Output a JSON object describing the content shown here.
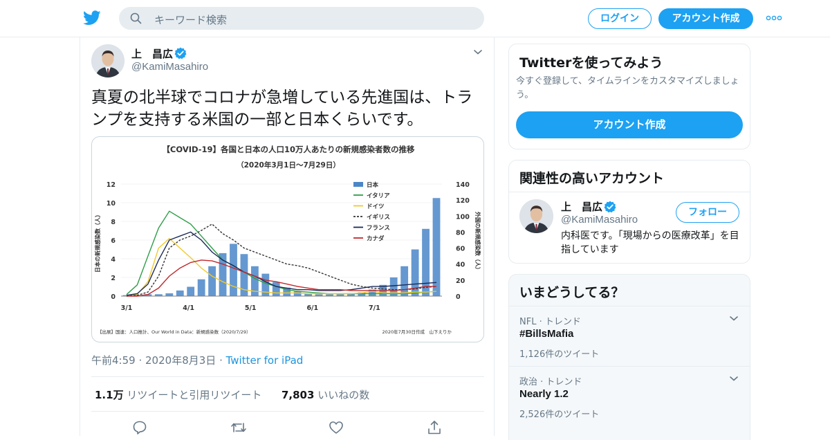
{
  "header": {
    "search_placeholder": "キーワード検索",
    "login_label": "ログイン",
    "signup_label": "アカウント作成"
  },
  "tweet": {
    "author_name": "上　昌広",
    "author_handle": "@KamiMasahiro",
    "text": "真夏の北半球でコロナが急増している先進国は、トランプを支持する米国の一部と日本くらいです。",
    "time": "午前4:59",
    "date": "2020年8月3日",
    "source": "Twitter for iPad",
    "retweet_count": "1.1万",
    "retweet_label": "リツイートと引用リツイート",
    "like_count": "7,803",
    "like_label": "いいねの数"
  },
  "chart_image": {
    "title": "【COVID-19】各国と日本の人口10万人あたりの新規感染者数の推移",
    "subtitle": "（2020年3月1日〜7月29日）",
    "ylabel_left": "日本の新規感染数（人）",
    "ylabel_right": "外国の新規感染数（人）",
    "source_note": "【出展】国連：人口推計、Our World in Data：新規感染数（2020/7/29）",
    "credit_note": "2020年7月30日作成　山下えりか"
  },
  "chart_data": {
    "type": "bar",
    "title": "【COVID-19】各国と日本の人口10万人あたりの新規感染者数の推移",
    "subtitle": "（2020年3月1日〜7月29日）",
    "xlabel": "",
    "ylabel": "日本の新規感染数（人）",
    "ylabel_right": "外国の新規感染数（人）",
    "x_ticks": [
      "3/1",
      "4/1",
      "5/1",
      "6/1",
      "7/1"
    ],
    "y_ticks_left": [
      "0",
      "2",
      "4",
      "6",
      "8",
      "10",
      "12"
    ],
    "y_ticks_right": [
      "0",
      "20",
      "40",
      "60",
      "80",
      "100",
      "120",
      "140"
    ],
    "ylim": [
      0,
      12
    ],
    "ylim_right": [
      0,
      140
    ],
    "legend_position": "top-right",
    "legend": [
      "日本",
      "イタリア",
      "ドイツ",
      "イギリス",
      "フランス",
      "カナダ"
    ],
    "series": [
      {
        "name": "日本",
        "axis": "left",
        "style": "bar",
        "color": "#4a86c8",
        "values": [
          0.1,
          0.1,
          0.2,
          0.2,
          0.3,
          0.6,
          1.0,
          1.8,
          3.2,
          4.6,
          5.6,
          4.5,
          3.2,
          2.4,
          1.5,
          0.9,
          0.5,
          0.3,
          0.2,
          0.2,
          0.2,
          0.3,
          0.4,
          0.7,
          1.2,
          2.0,
          3.2,
          5.0,
          7.2,
          10.5
        ]
      },
      {
        "name": "イタリア",
        "axis": "right",
        "style": "line",
        "color": "#2e9e48",
        "values": [
          2,
          14,
          50,
          85,
          106,
          98,
          90,
          75,
          60,
          45,
          38,
          30,
          22,
          16,
          12,
          8,
          6,
          5,
          4,
          3,
          3,
          3,
          3,
          3,
          3,
          3,
          3,
          4,
          5,
          6
        ]
      },
      {
        "name": "ドイツ",
        "axis": "right",
        "style": "line",
        "color": "#f1c92b",
        "values": [
          0,
          2,
          18,
          60,
          72,
          60,
          48,
          35,
          25,
          18,
          12,
          8,
          6,
          5,
          4,
          4,
          4,
          3,
          3,
          3,
          3,
          3,
          4,
          6,
          4,
          4,
          4,
          5,
          5,
          6
        ]
      },
      {
        "name": "イギリス",
        "axis": "right",
        "style": "dashed",
        "color": "#333333",
        "values": [
          0,
          1,
          5,
          25,
          60,
          70,
          75,
          82,
          90,
          78,
          70,
          60,
          55,
          50,
          45,
          40,
          38,
          35,
          30,
          25,
          20,
          15,
          12,
          10,
          9,
          8,
          8,
          9,
          11,
          12
        ]
      },
      {
        "name": "フランス",
        "axis": "right",
        "style": "line",
        "color": "#1b2a5a",
        "values": [
          1,
          3,
          15,
          45,
          70,
          75,
          80,
          70,
          55,
          45,
          38,
          30,
          25,
          18,
          12,
          10,
          8,
          8,
          7,
          7,
          7,
          8,
          10,
          12,
          12,
          13,
          14,
          15,
          16,
          17
        ]
      },
      {
        "name": "カナダ",
        "axis": "right",
        "style": "line",
        "color": "#c0282b",
        "values": [
          0,
          0,
          2,
          10,
          25,
          35,
          42,
          45,
          44,
          40,
          35,
          30,
          25,
          20,
          18,
          15,
          12,
          10,
          8,
          8,
          8,
          7,
          7,
          7,
          7,
          7,
          8,
          10,
          12,
          12
        ]
      }
    ]
  },
  "signup_card": {
    "title": "Twitterを使ってみよう",
    "desc": "今すぐ登録して、タイムラインをカスタマイズしましょう。",
    "button": "アカウント作成"
  },
  "related_card": {
    "title": "関連性の高いアカウント",
    "name": "上　昌広",
    "handle": "@KamiMasahiro",
    "follow_label": "フォロー",
    "bio": "内科医です。「現場からの医療改革」を目指しています"
  },
  "trends_card": {
    "title": "いまどうしてる？",
    "items": [
      {
        "context": "NFL · トレンド",
        "name": "#BillsMafia",
        "count": "1,126件のツイート"
      },
      {
        "context": "政治 · トレンド",
        "name": "Nearly 1.2",
        "count": "2,526件のツイート"
      }
    ]
  },
  "colors": {
    "brand": "#1da1f2",
    "link": "#1b95e0",
    "muted": "#657786",
    "border": "#e6ecf0"
  }
}
